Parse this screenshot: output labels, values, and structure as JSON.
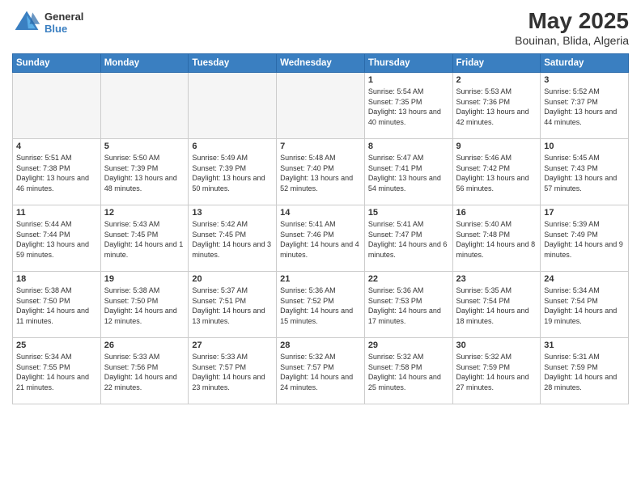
{
  "header": {
    "logo_general": "General",
    "logo_blue": "Blue",
    "main_title": "May 2025",
    "subtitle": "Bouinan, Blida, Algeria"
  },
  "days_of_week": [
    "Sunday",
    "Monday",
    "Tuesday",
    "Wednesday",
    "Thursday",
    "Friday",
    "Saturday"
  ],
  "weeks": [
    [
      {
        "day": "",
        "empty": true
      },
      {
        "day": "",
        "empty": true
      },
      {
        "day": "",
        "empty": true
      },
      {
        "day": "",
        "empty": true
      },
      {
        "day": "1",
        "sunrise": "5:54 AM",
        "sunset": "7:35 PM",
        "daylight": "13 hours and 40 minutes."
      },
      {
        "day": "2",
        "sunrise": "5:53 AM",
        "sunset": "7:36 PM",
        "daylight": "13 hours and 42 minutes."
      },
      {
        "day": "3",
        "sunrise": "5:52 AM",
        "sunset": "7:37 PM",
        "daylight": "13 hours and 44 minutes."
      }
    ],
    [
      {
        "day": "4",
        "sunrise": "5:51 AM",
        "sunset": "7:38 PM",
        "daylight": "13 hours and 46 minutes."
      },
      {
        "day": "5",
        "sunrise": "5:50 AM",
        "sunset": "7:39 PM",
        "daylight": "13 hours and 48 minutes."
      },
      {
        "day": "6",
        "sunrise": "5:49 AM",
        "sunset": "7:39 PM",
        "daylight": "13 hours and 50 minutes."
      },
      {
        "day": "7",
        "sunrise": "5:48 AM",
        "sunset": "7:40 PM",
        "daylight": "13 hours and 52 minutes."
      },
      {
        "day": "8",
        "sunrise": "5:47 AM",
        "sunset": "7:41 PM",
        "daylight": "13 hours and 54 minutes."
      },
      {
        "day": "9",
        "sunrise": "5:46 AM",
        "sunset": "7:42 PM",
        "daylight": "13 hours and 56 minutes."
      },
      {
        "day": "10",
        "sunrise": "5:45 AM",
        "sunset": "7:43 PM",
        "daylight": "13 hours and 57 minutes."
      }
    ],
    [
      {
        "day": "11",
        "sunrise": "5:44 AM",
        "sunset": "7:44 PM",
        "daylight": "13 hours and 59 minutes."
      },
      {
        "day": "12",
        "sunrise": "5:43 AM",
        "sunset": "7:45 PM",
        "daylight": "14 hours and 1 minute."
      },
      {
        "day": "13",
        "sunrise": "5:42 AM",
        "sunset": "7:45 PM",
        "daylight": "14 hours and 3 minutes."
      },
      {
        "day": "14",
        "sunrise": "5:41 AM",
        "sunset": "7:46 PM",
        "daylight": "14 hours and 4 minutes."
      },
      {
        "day": "15",
        "sunrise": "5:41 AM",
        "sunset": "7:47 PM",
        "daylight": "14 hours and 6 minutes."
      },
      {
        "day": "16",
        "sunrise": "5:40 AM",
        "sunset": "7:48 PM",
        "daylight": "14 hours and 8 minutes."
      },
      {
        "day": "17",
        "sunrise": "5:39 AM",
        "sunset": "7:49 PM",
        "daylight": "14 hours and 9 minutes."
      }
    ],
    [
      {
        "day": "18",
        "sunrise": "5:38 AM",
        "sunset": "7:50 PM",
        "daylight": "14 hours and 11 minutes."
      },
      {
        "day": "19",
        "sunrise": "5:38 AM",
        "sunset": "7:50 PM",
        "daylight": "14 hours and 12 minutes."
      },
      {
        "day": "20",
        "sunrise": "5:37 AM",
        "sunset": "7:51 PM",
        "daylight": "14 hours and 13 minutes."
      },
      {
        "day": "21",
        "sunrise": "5:36 AM",
        "sunset": "7:52 PM",
        "daylight": "14 hours and 15 minutes."
      },
      {
        "day": "22",
        "sunrise": "5:36 AM",
        "sunset": "7:53 PM",
        "daylight": "14 hours and 17 minutes."
      },
      {
        "day": "23",
        "sunrise": "5:35 AM",
        "sunset": "7:54 PM",
        "daylight": "14 hours and 18 minutes."
      },
      {
        "day": "24",
        "sunrise": "5:34 AM",
        "sunset": "7:54 PM",
        "daylight": "14 hours and 19 minutes."
      }
    ],
    [
      {
        "day": "25",
        "sunrise": "5:34 AM",
        "sunset": "7:55 PM",
        "daylight": "14 hours and 21 minutes."
      },
      {
        "day": "26",
        "sunrise": "5:33 AM",
        "sunset": "7:56 PM",
        "daylight": "14 hours and 22 minutes."
      },
      {
        "day": "27",
        "sunrise": "5:33 AM",
        "sunset": "7:57 PM",
        "daylight": "14 hours and 23 minutes."
      },
      {
        "day": "28",
        "sunrise": "5:32 AM",
        "sunset": "7:57 PM",
        "daylight": "14 hours and 24 minutes."
      },
      {
        "day": "29",
        "sunrise": "5:32 AM",
        "sunset": "7:58 PM",
        "daylight": "14 hours and 25 minutes."
      },
      {
        "day": "30",
        "sunrise": "5:32 AM",
        "sunset": "7:59 PM",
        "daylight": "14 hours and 27 minutes."
      },
      {
        "day": "31",
        "sunrise": "5:31 AM",
        "sunset": "7:59 PM",
        "daylight": "14 hours and 28 minutes."
      }
    ]
  ],
  "labels": {
    "sunrise": "Sunrise:",
    "sunset": "Sunset:",
    "daylight": "Daylight:"
  }
}
